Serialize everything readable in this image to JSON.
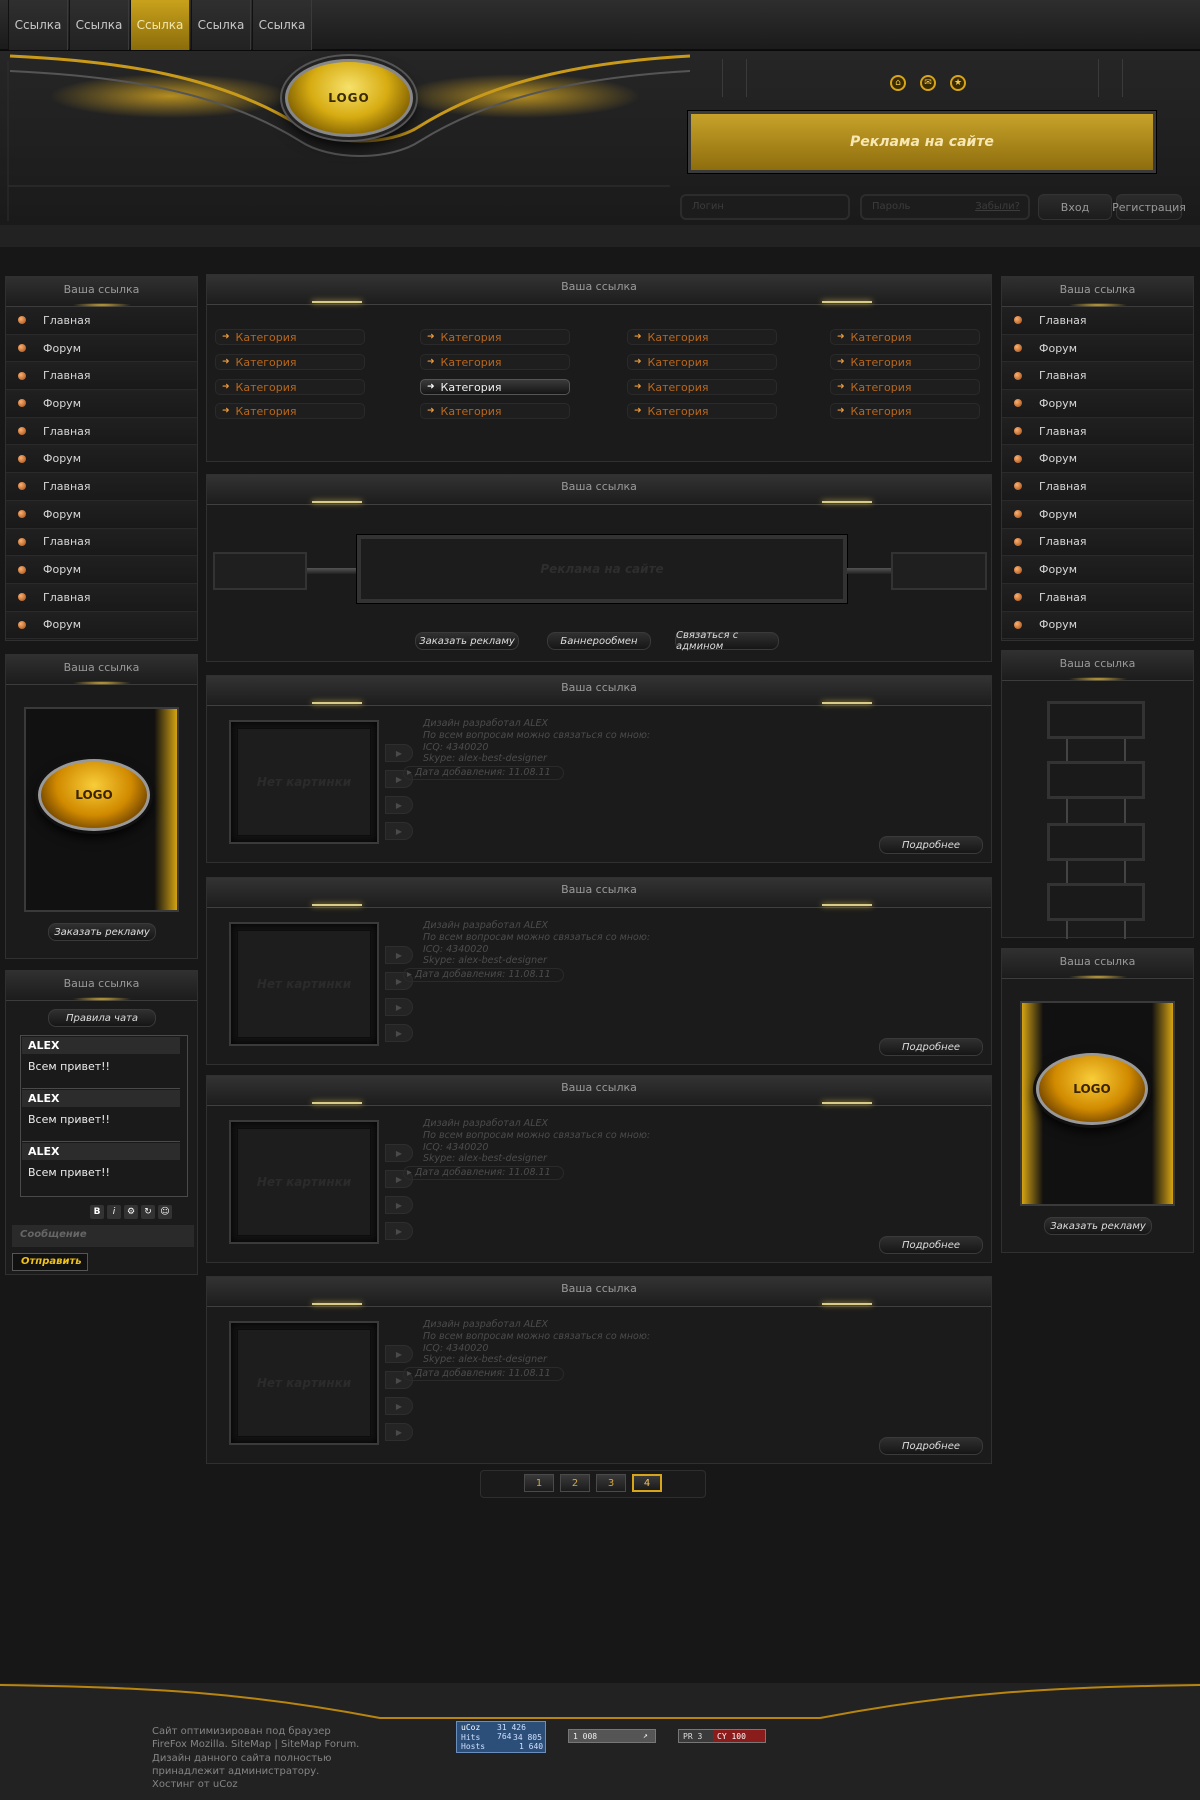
{
  "nav": {
    "tabs": [
      {
        "label": "Ссылка"
      },
      {
        "label": "Ссылка"
      },
      {
        "label": "Ссылка",
        "active": true
      },
      {
        "label": "Ссылка"
      },
      {
        "label": "Ссылка"
      }
    ]
  },
  "header": {
    "logo_text": "LOGO",
    "ad_text": "Реклама на сайте",
    "login_placeholder": "Логин",
    "password_placeholder": "Пароль",
    "forgot_label": "Забыли?",
    "login_button": "Вход",
    "register_button": "Регистрация"
  },
  "left_menu": {
    "title": "Ваша ссылка",
    "items": [
      "Главная",
      "Форум",
      "Главная",
      "Форум",
      "Главная",
      "Форум",
      "Главная",
      "Форум",
      "Главная",
      "Форум",
      "Главная",
      "Форум"
    ]
  },
  "right_menu": {
    "title": "Ваша ссылка",
    "items": [
      "Главная",
      "Форум",
      "Главная",
      "Форум",
      "Главная",
      "Форум",
      "Главная",
      "Форум",
      "Главная",
      "Форум",
      "Главная",
      "Форум"
    ]
  },
  "left_ad": {
    "title": "Ваша ссылка",
    "logo_text": "LOGO",
    "button": "Заказать рекламу"
  },
  "chat": {
    "title": "Ваша ссылка",
    "rules_button": "Правила чата",
    "messages": [
      {
        "name": "ALEX",
        "text": "Всем привет!!"
      },
      {
        "name": "ALEX",
        "text": "Всем привет!!"
      },
      {
        "name": "ALEX",
        "text": "Всем привет!!"
      }
    ],
    "message_placeholder": "Сообщение",
    "send_button": "Отправить"
  },
  "categories": {
    "title": "Ваша ссылка",
    "items": [
      "Категория",
      "Категория",
      "Категория",
      "Категория",
      "Категория",
      "Категория",
      "Категория",
      "Категория",
      "Категория",
      "Категория",
      "Категория",
      "Категория",
      "Категория",
      "Категория",
      "Категория",
      "Категория"
    ],
    "active_index": 6
  },
  "ad_block": {
    "title": "Ваша ссылка",
    "ad_text": "Реклама на сайте",
    "buttons": [
      "Заказать рекламу",
      "Баннерообмен",
      "Связаться с админом"
    ]
  },
  "news": [
    {
      "title": "Ваша ссылка",
      "no_image": "Нет картинки",
      "lines": [
        "Дизайн разработал ALEX",
        "По всем вопросам можно связаться со мною:",
        "ICQ: 4340020",
        "Skype: alex-best-designer"
      ],
      "date": "Дата добавления: 11.08.11",
      "more": "Подробнее"
    },
    {
      "title": "Ваша ссылка",
      "no_image": "Нет картинки",
      "lines": [
        "Дизайн разработал ALEX",
        "По всем вопросам можно связаться со мною:",
        "ICQ: 4340020",
        "Skype: alex-best-designer"
      ],
      "date": "Дата добавления: 11.08.11",
      "more": "Подробнее"
    },
    {
      "title": "Ваша ссылка",
      "no_image": "Нет картинки",
      "lines": [
        "Дизайн разработал ALEX",
        "По всем вопросам можно связаться со мною:",
        "ICQ: 4340020",
        "Skype: alex-best-designer"
      ],
      "date": "Дата добавления: 11.08.11",
      "more": "Подробнее"
    },
    {
      "title": "Ваша ссылка",
      "no_image": "Нет картинки",
      "lines": [
        "Дизайн разработал ALEX",
        "По всем вопросам можно связаться со мною:",
        "ICQ: 4340020",
        "Skype: alex-best-designer"
      ],
      "date": "Дата добавления: 11.08.11",
      "more": "Подробнее"
    }
  ],
  "pager": {
    "pages": [
      "1",
      "2",
      "3",
      "4"
    ],
    "active": "4"
  },
  "right_banners": {
    "title": "Ваша ссылка"
  },
  "right_ad": {
    "title": "Ваша ссылка",
    "logo_text": "LOGO",
    "button": "Заказать рекламу"
  },
  "footer": {
    "lines": [
      "Сайт оптимизирован под браузер",
      "FireFox Mozilla. SiteMap | SiteMap Forum.",
      "Дизайн данного сайта полностью",
      "принадлежит администратору.",
      "Хостинг от uCoz"
    ],
    "counter1": {
      "brand": "uCoz",
      "total": "31 426 764",
      "hits_label": "Hits",
      "hits": "34 805",
      "hosts_label": "Hosts",
      "hosts": "1 640"
    },
    "counter2": {
      "value": "1 008"
    },
    "counter3": {
      "pr": "PR 3",
      "cy": "CY 100"
    }
  },
  "colors": {
    "accent": "#d7a51a",
    "background": "#171717",
    "panel": "#1b1b1b",
    "category_text": "#b9671b"
  }
}
